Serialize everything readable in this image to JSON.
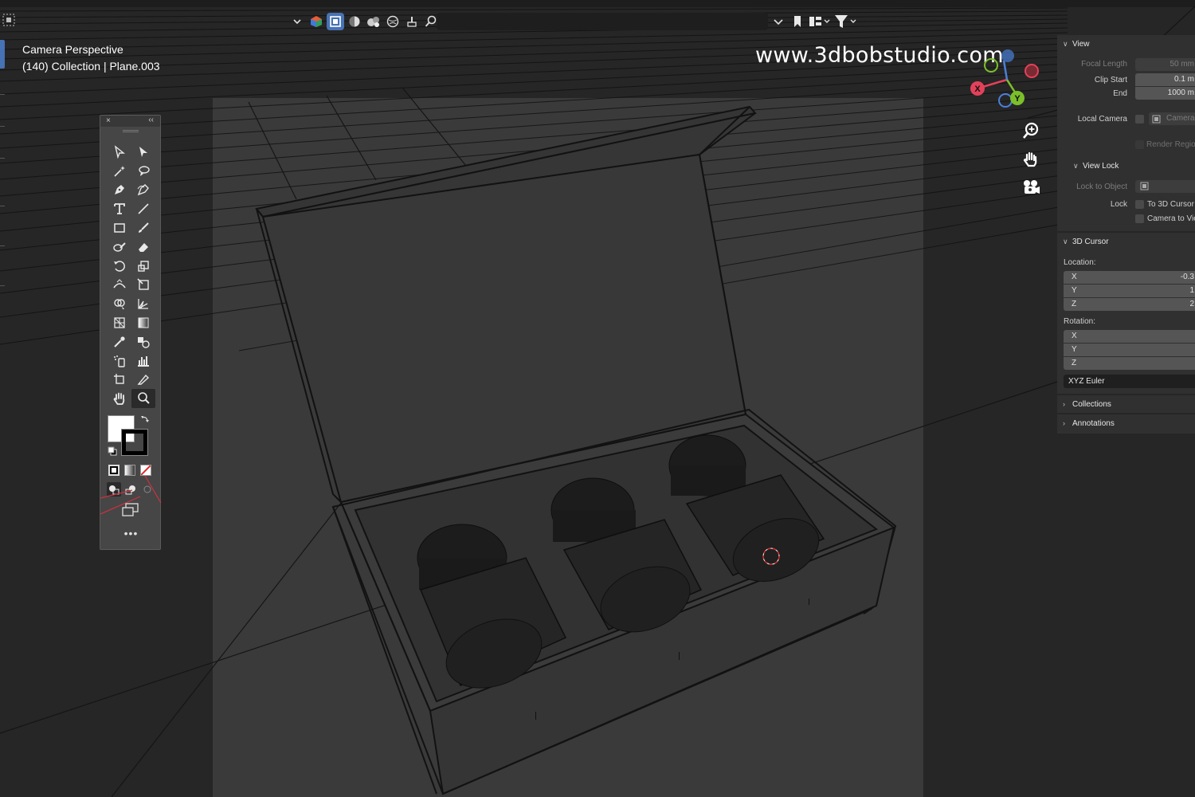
{
  "viewport": {
    "info_line1": "Camera Perspective",
    "info_line2": "(140) Collection | Plane.003",
    "watermark": "www.3dbobstudio.com"
  },
  "gizmo": {
    "x_label": "X",
    "y_label": "Y",
    "x_color": "#e3415a",
    "y_color": "#7bbf2a",
    "z_color": "#4a7fd9"
  },
  "colors": {
    "accent": "#4772b3",
    "selection_red": "#e02a2a"
  },
  "toolbar": {
    "icons": [
      "chevron-down-icon",
      "gizmo-toggle-icon",
      "wireframe-shading-icon",
      "solid-shading-icon",
      "material-shading-icon",
      "rendered-shading-icon",
      "brush-icon",
      "search-icon"
    ],
    "right_icons": [
      "chevron-down-icon",
      "bookmark-icon",
      "hierarchy-icon",
      "filter-icon"
    ]
  },
  "tools_panel": {
    "close": "×",
    "collapse": "‹‹",
    "more": "•••"
  },
  "sidebar": {
    "view": {
      "title": "View",
      "focal_length_label": "Focal Length",
      "focal_length_value": "50 mm",
      "clip_start_label": "Clip Start",
      "clip_start_value": "0.1 m",
      "clip_end_label": "End",
      "clip_end_value": "1000 m",
      "local_camera_label": "Local Camera",
      "local_camera_value": "Camera",
      "render_region_label": "Render Region"
    },
    "view_lock": {
      "title": "View Lock",
      "lock_to_object_label": "Lock to Object",
      "lock_label": "Lock",
      "to_3d_cursor_label": "To 3D Cursor",
      "camera_to_view_label": "Camera to View"
    },
    "cursor": {
      "title": "3D Cursor",
      "location_label": "Location:",
      "loc": [
        {
          "axis": "X",
          "value": "-0.3"
        },
        {
          "axis": "Y",
          "value": "1"
        },
        {
          "axis": "Z",
          "value": "2"
        }
      ],
      "rotation_label": "Rotation:",
      "rot": [
        {
          "axis": "X",
          "value": ""
        },
        {
          "axis": "Y",
          "value": ""
        },
        {
          "axis": "Z",
          "value": ""
        }
      ],
      "rotation_mode": "XYZ Euler"
    },
    "collections": "Collections",
    "annotations": "Annotations"
  }
}
